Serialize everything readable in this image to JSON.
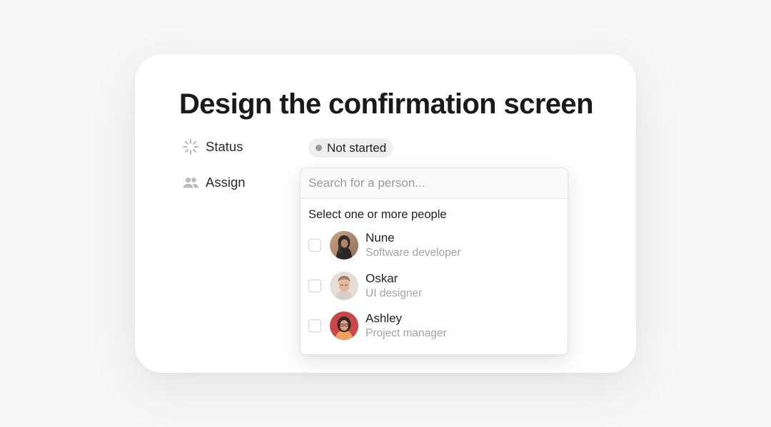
{
  "task": {
    "title": "Design the confirmation screen"
  },
  "properties": {
    "status": {
      "label": "Status",
      "icon": "loader-icon",
      "value": "Not started",
      "dot_color": "#9a9a9a"
    },
    "assign": {
      "label": "Assign",
      "icon": "people-icon"
    }
  },
  "assign_popover": {
    "search_placeholder": "Search for a person...",
    "heading": "Select one or more people",
    "people": [
      {
        "name": "Nune",
        "role": "Software developer",
        "checked": false
      },
      {
        "name": "Oskar",
        "role": "UI designer",
        "checked": false
      },
      {
        "name": "Ashley",
        "role": "Project manager",
        "checked": false
      }
    ]
  }
}
